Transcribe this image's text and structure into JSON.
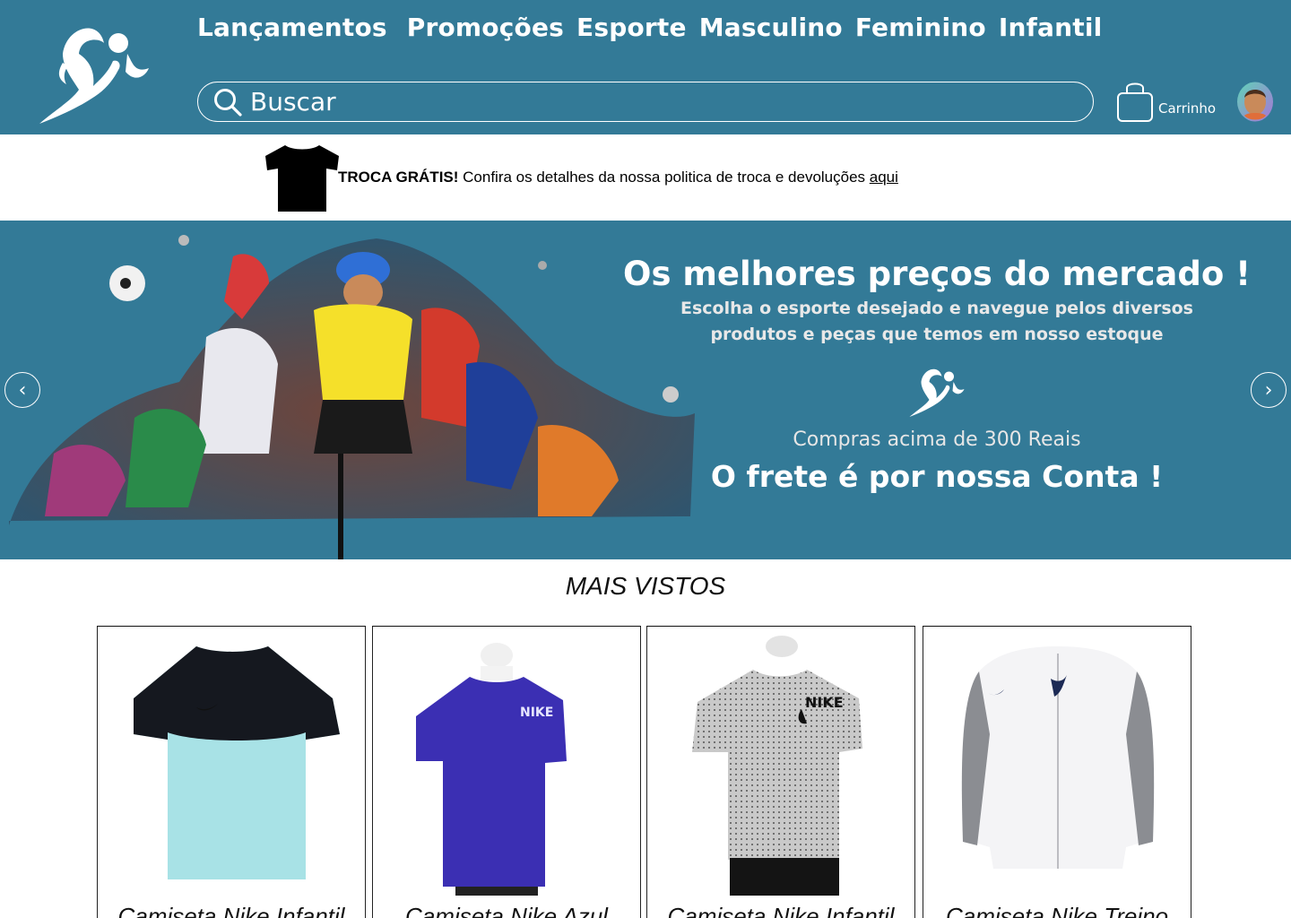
{
  "header": {
    "logo_icon": "runner-logo-icon",
    "nav": [
      "Lançamentos",
      "Promoções",
      "Esporte",
      "Masculino",
      "Feminino",
      "Infantil"
    ],
    "search": {
      "placeholder": "Buscar",
      "icon": "search-icon"
    },
    "cart": {
      "label": "Carrinho",
      "icon": "shopping-bag-icon"
    },
    "avatar_icon": "user-avatar-icon"
  },
  "notice": {
    "icon": "tshirt-icon",
    "bold": "TROCA GRÁTIS!",
    "text": " Confira os detalhes da nossa politica de troca e devoluções ",
    "link": "aqui"
  },
  "banner": {
    "title": "Os melhores preços do mercado !",
    "subtitle_line1": "Escolha o esporte desejado e navegue pelos diversos",
    "subtitle_line2": "produtos e peças que temos em nosso estoque",
    "small": "Compras acima de 300 Reais",
    "big": "O frete é por nossa Conta !",
    "prev": "‹",
    "next": "›"
  },
  "most_viewed": {
    "title": "MAIS VISTOS",
    "products": [
      {
        "name": "Camiseta Nike Infantil"
      },
      {
        "name": "Camiseta Nike Azul"
      },
      {
        "name": "Camiseta Nike Infantil"
      },
      {
        "name": "Camiseta Nike Treino"
      }
    ]
  },
  "colors": {
    "brand": "#337a97",
    "white": "#ffffff"
  }
}
